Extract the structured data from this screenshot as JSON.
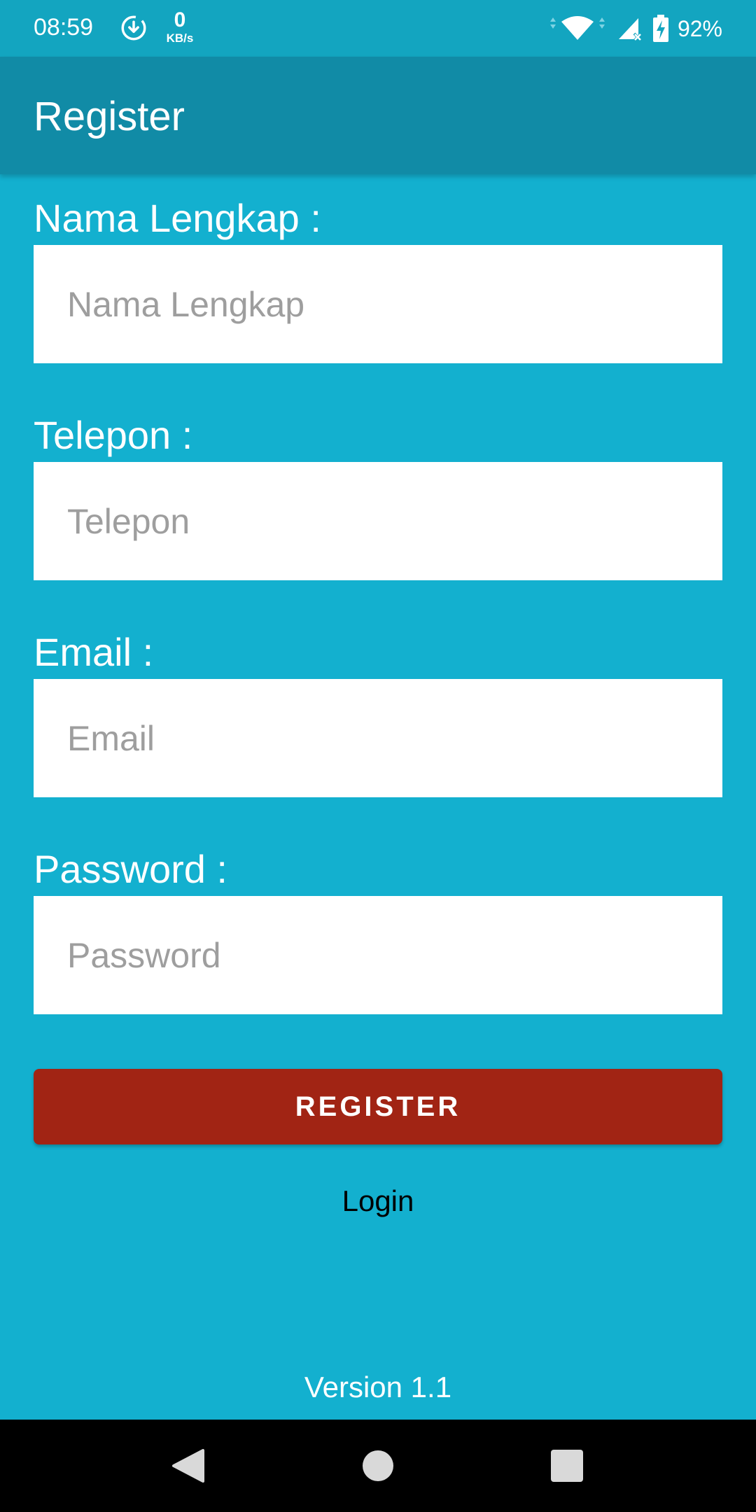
{
  "status_bar": {
    "time": "08:59",
    "net_speed_value": "0",
    "net_speed_unit": "KB/s",
    "battery_percent": "92%"
  },
  "app_bar": {
    "title": "Register"
  },
  "form": {
    "fullname": {
      "label": "Nama Lengkap :",
      "placeholder": "Nama Lengkap",
      "value": ""
    },
    "phone": {
      "label": "Telepon :",
      "placeholder": "Telepon",
      "value": ""
    },
    "email": {
      "label": "Email :",
      "placeholder": "Email",
      "value": ""
    },
    "password": {
      "label": "Password :",
      "placeholder": "Password",
      "value": ""
    }
  },
  "register_button_label": "REGISTER",
  "login_link": "Login",
  "version": "Version 1.1",
  "icons": {
    "status": [
      "download-icon",
      "wifi-icon",
      "signal-icon",
      "battery-charging-icon"
    ],
    "nav": [
      "back-icon",
      "home-icon",
      "recents-icon"
    ]
  },
  "colors": {
    "background": "#13b0cf",
    "app_bar": "#118ba6",
    "status_bar": "#13a5c0",
    "register_button": "#a12414"
  }
}
